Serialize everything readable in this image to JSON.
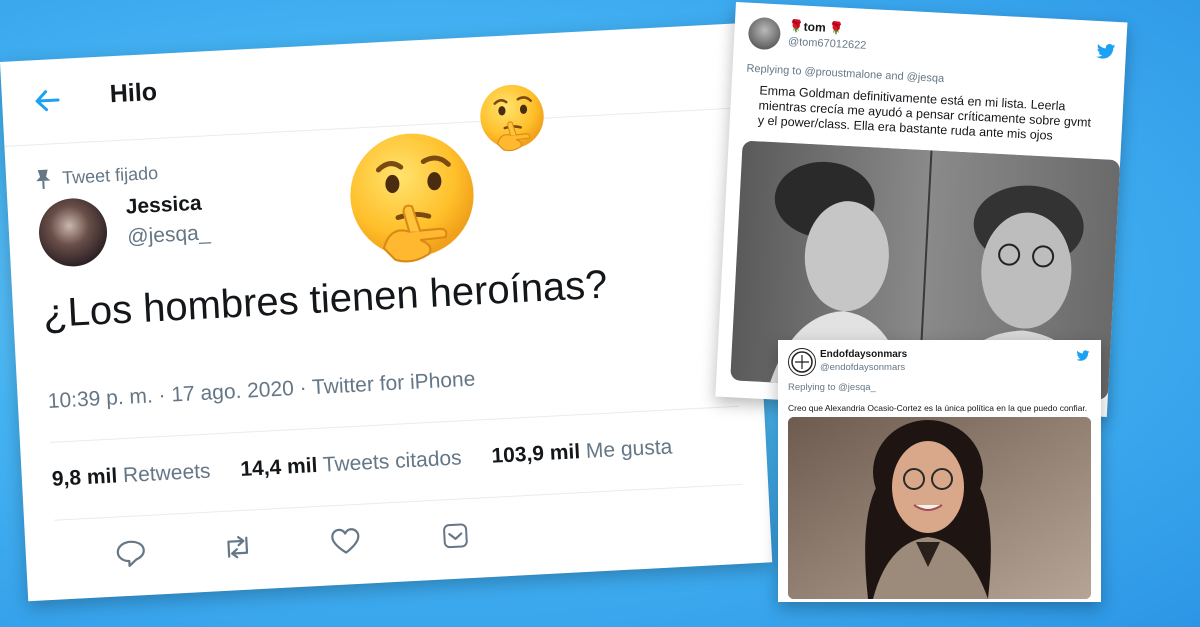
{
  "main_tweet": {
    "header_title": "Hilo",
    "pinned_label": "Tweet fijado",
    "user_name": "Jessica",
    "user_handle": "@jesqa_",
    "text": "¿Los hombres tienen heroínas?",
    "meta": "10:39 p. m. · 17 ago. 2020 · Twitter for iPhone",
    "stats": {
      "retweets_count": "9,8 mil",
      "retweets_label": "Retweets",
      "quotes_count": "14,4 mil",
      "quotes_label": "Tweets citados",
      "likes_count": "103,9 mil",
      "likes_label": "Me gusta"
    },
    "actions": [
      "reply-icon",
      "retweet-icon",
      "like-icon",
      "share-icon"
    ]
  },
  "reply_tom": {
    "user_name": "🌹tom 🌹",
    "user_handle": "@tom67012622",
    "replying_to": "Replying to @proustmalone and @jesqa",
    "text": "Emma Goldman definitivamente está en mi lista. Leerla mientras crecía me ayudó a pensar críticamente sobre gvmt y el power/class. Ella era bastante ruda ante mis ojos"
  },
  "reply_endofdays": {
    "user_name": "Endofdaysonmars",
    "user_handle": "@endofdaysonmars",
    "replying_to": "Replying to @jesqa_",
    "text": "Creo que Alexandria Ocasio-Cortez es la única política en la que puedo confiar."
  },
  "colors": {
    "twitter_blue": "#1da1f2",
    "text_primary": "#14171a",
    "text_secondary": "#657786",
    "background": "#45b4f3"
  },
  "icons": [
    "thinking-face-emoji",
    "twitter-bird-icon",
    "back-arrow-icon",
    "pin-icon"
  ]
}
